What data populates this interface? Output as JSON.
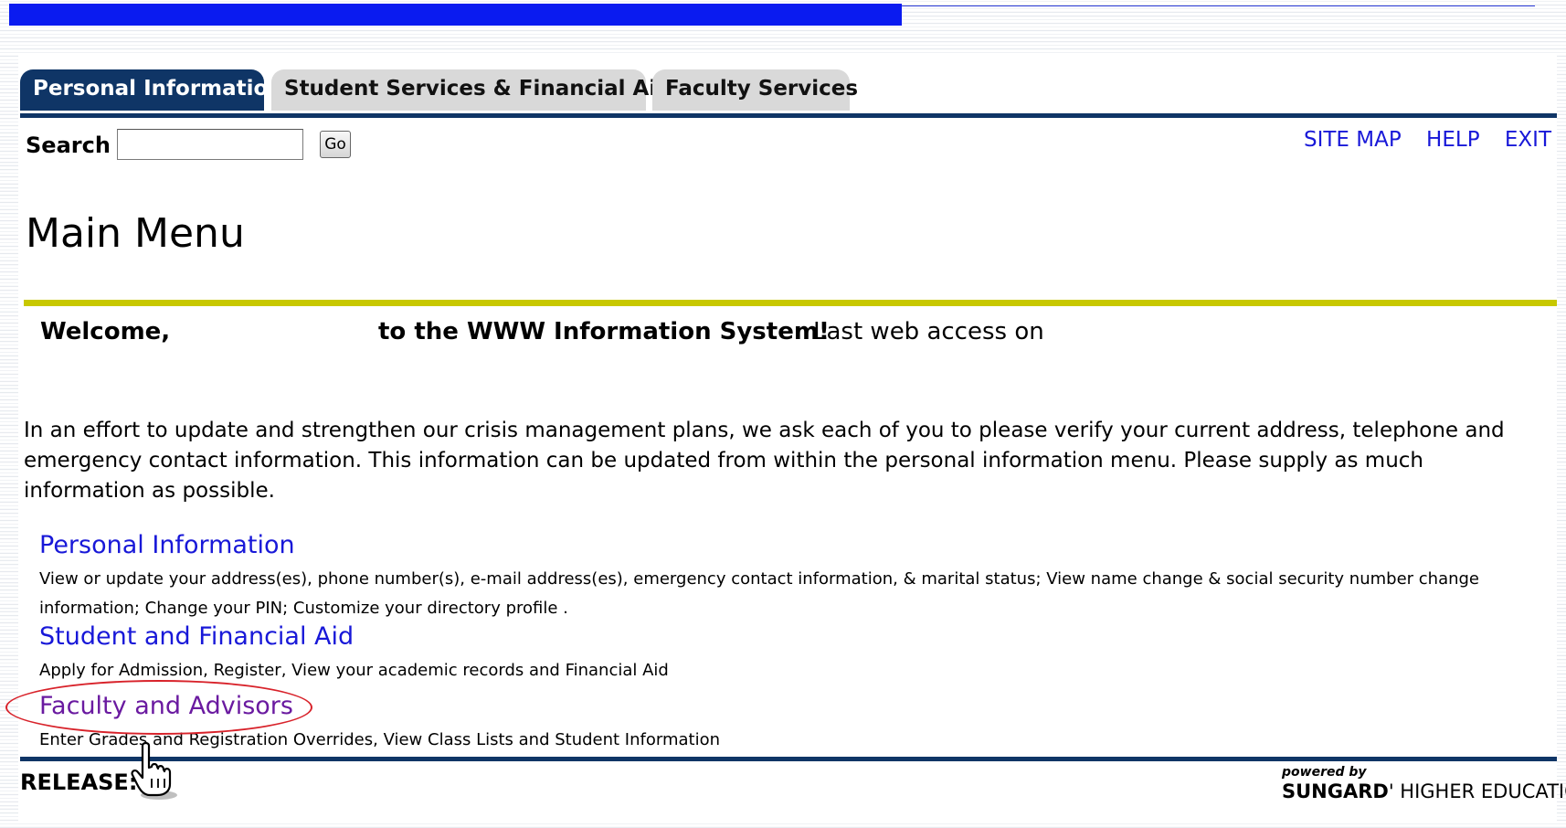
{
  "tabs": [
    {
      "label": "Personal Information"
    },
    {
      "label": "Student Services & Financial Aid"
    },
    {
      "label": "Faculty Services"
    }
  ],
  "search": {
    "label": "Search",
    "value": "",
    "go_label": "Go"
  },
  "top_links": [
    "SITE MAP",
    "HELP",
    "EXIT"
  ],
  "page_title": "Main Menu",
  "welcome": {
    "greeting": "Welcome,",
    "system": "to the WWW Information System!",
    "last_access": "Last web access on"
  },
  "notice": "In an effort to update and strengthen our crisis management plans, we ask each of you to please verify your current address, telephone and emergency contact information. This information can be updated from within the personal information menu. Please supply as much information as possible.",
  "menu": [
    {
      "label": "Personal Information",
      "desc": "View or update your address(es), phone number(s), e-mail address(es), emergency contact information, & marital status; View name change & social security number change information; Change your PIN; Customize your directory profile ."
    },
    {
      "label": "Student and Financial Aid",
      "desc": "Apply for Admission, Register, View your academic records and Financial Aid"
    },
    {
      "label": "Faculty and Advisors",
      "desc": "Enter Grades and Registration Overrides, View Class Lists and Student Information"
    }
  ],
  "footer": {
    "release": "RELEASE: 8.",
    "powered_by": "powered by",
    "brand_bold": "SUNGARD",
    "brand_rest": "HIGHER EDUCATION"
  },
  "colors": {
    "navy": "#0f3566",
    "olive": "#c8c800",
    "link": "#1818d8",
    "visited": "#6a1aa0",
    "highlight": "#d8222a"
  },
  "icons": {
    "cursor": "hand-pointer-icon"
  }
}
